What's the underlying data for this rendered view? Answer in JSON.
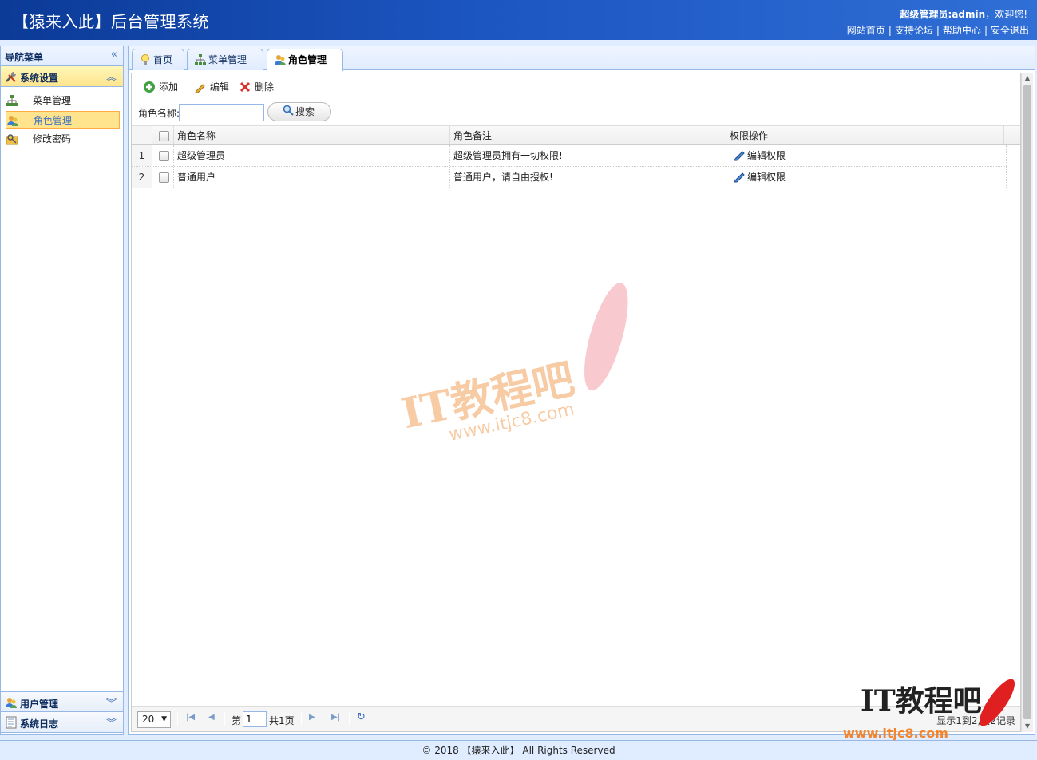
{
  "header": {
    "title": "【猿来入此】后台管理系统",
    "welcome_user": "超级管理员:admin",
    "welcome_suffix": "，欢迎您!",
    "links": [
      "网站首页",
      "支持论坛",
      "帮助中心",
      "安全退出"
    ]
  },
  "nav": {
    "title": "导航菜单",
    "sections": [
      {
        "label": "系统设置",
        "icon": "tools-icon"
      },
      {
        "label": "用户管理",
        "icon": "users-icon"
      },
      {
        "label": "系统日志",
        "icon": "log-icon"
      }
    ],
    "items": [
      {
        "label": "菜单管理",
        "icon": "sitemap-icon"
      },
      {
        "label": "角色管理",
        "icon": "role-icon",
        "selected": true
      },
      {
        "label": "修改密码",
        "icon": "key-icon"
      }
    ]
  },
  "tabs": [
    {
      "label": "首页",
      "icon": "lightbulb-icon",
      "closable": false
    },
    {
      "label": "菜单管理",
      "icon": "sitemap-icon",
      "closable": true
    },
    {
      "label": "角色管理",
      "icon": "role-icon",
      "closable": true,
      "active": true
    }
  ],
  "toolbar": {
    "add_label": "添加",
    "edit_label": "编辑",
    "delete_label": "删除"
  },
  "search": {
    "label": "角色名称:",
    "value": "",
    "button_label": "搜索"
  },
  "grid": {
    "columns": [
      "角色名称",
      "角色备注",
      "权限操作"
    ],
    "rows": [
      {
        "num": "1",
        "name": "超级管理员",
        "remark": "超级管理员拥有一切权限!",
        "action": "编辑权限"
      },
      {
        "num": "2",
        "name": "普通用户",
        "remark": "普通用户，请自由授权!",
        "action": "编辑权限"
      }
    ]
  },
  "pager": {
    "page_size": "20",
    "page_prefix": "第",
    "page_value": "1",
    "page_suffix": "共1页",
    "info": "显示1到2,共2记录"
  },
  "footer": {
    "text": "© 2018 【猿来入此】 All Rights Reserved"
  },
  "watermark": {
    "brand": "IT教程吧",
    "url": "www.itjc8.com"
  },
  "colors": {
    "header_bg": "#1c55c0",
    "panel_border": "#95b8e7",
    "selected_bg": "#ffe48d"
  }
}
